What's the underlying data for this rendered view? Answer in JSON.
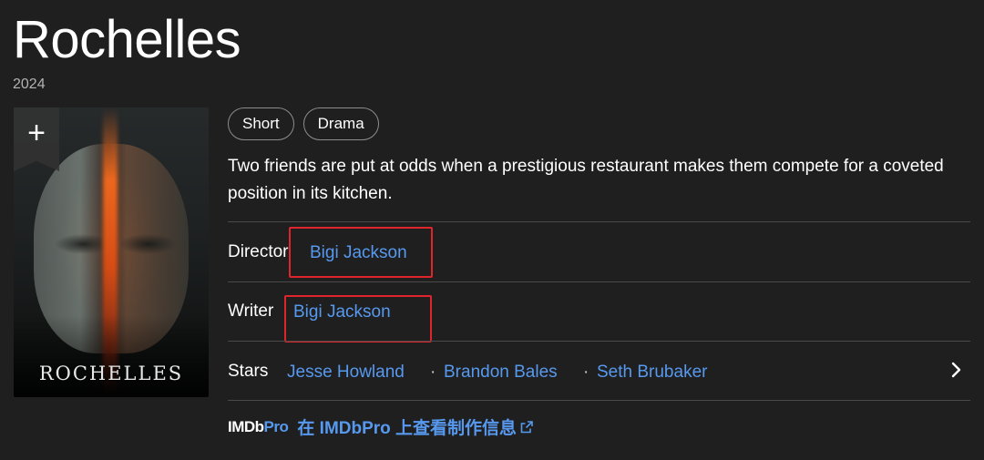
{
  "title": "Rochelles",
  "year": "2024",
  "poster": {
    "text": "ROCHELLES",
    "add_icon": "plus-icon"
  },
  "genres": [
    "Short",
    "Drama"
  ],
  "plot": "Two friends are put at odds when a prestigious restaurant makes them compete for a coveted position in its kitchen.",
  "credits": {
    "director_label": "Director",
    "director": "Bigi Jackson",
    "writer_label": "Writer",
    "writer": "Bigi Jackson",
    "stars_label": "Stars",
    "stars": [
      "Jesse Howland",
      "Brandon Bales",
      "Seth Brubaker"
    ],
    "separator": "·",
    "more_icon": "chevron-right-icon"
  },
  "imdbpro": {
    "logo_main": "IMDb",
    "logo_pro": "Pro",
    "link": "在 IMDbPro 上查看制作信息",
    "external_icon": "external-link-icon"
  },
  "colors": {
    "background": "#1f1f1f",
    "link": "#5799ef",
    "highlight": "#e0242c",
    "divider": "#4a4a4a"
  }
}
